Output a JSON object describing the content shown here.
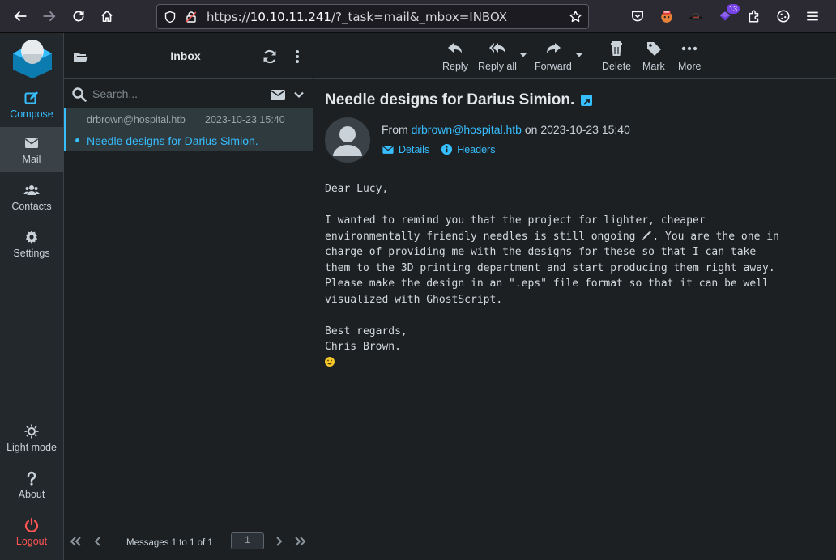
{
  "browser": {
    "url_prefix": "https://",
    "url_host": "10.10.11.241",
    "url_path": "/?_task=mail&_mbox=INBOX",
    "extension_badge": "13"
  },
  "taskmenu": {
    "compose": "Compose",
    "mail": "Mail",
    "contacts": "Contacts",
    "settings": "Settings",
    "light_mode": "Light mode",
    "about": "About",
    "logout": "Logout"
  },
  "list": {
    "title": "Inbox",
    "search_placeholder": "Search...",
    "messages": [
      {
        "from": "drbrown@hospital.htb",
        "date": "2023-10-23 15:40",
        "subject": "Needle designs for Darius Simion."
      }
    ],
    "count_text": "Messages 1 to 1 of 1",
    "page": "1"
  },
  "toolbar": {
    "reply": "Reply",
    "reply_all": "Reply all",
    "forward": "Forward",
    "delete": "Delete",
    "mark": "Mark",
    "more": "More"
  },
  "message": {
    "subject": "Needle designs for Darius Simion.",
    "from_prefix": "From",
    "from_email": "drbrown@hospital.htb",
    "date_prefix": "on",
    "date": "2023-10-23 15:40",
    "details": "Details",
    "headers": "Headers",
    "greeting": "Dear Lucy,",
    "para1_a": "I wanted to remind you that the project for lighter, cheaper\nenvironmentally friendly needles is still ongoing ",
    "para1_b": ". You are the one in\ncharge of providing me with the designs for these so that I can take\nthem to the 3D printing department and start producing them right away.\nPlease make the design in an \".eps\" file format so that it can be well\nvisualized with GhostScript.",
    "closing": "Best regards,\nChris Brown."
  },
  "colors": {
    "accent": "#37beff",
    "logout": "#ff5552",
    "background": "#1c2023",
    "sidebar": "#23282c"
  }
}
